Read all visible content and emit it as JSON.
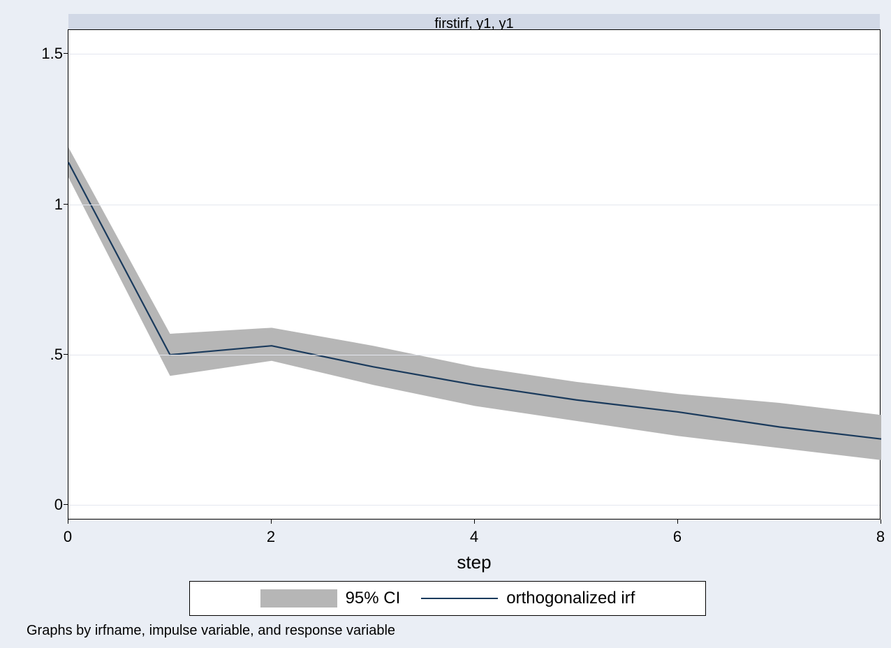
{
  "chart_data": {
    "type": "line",
    "panel_title": "firstirf, y1, y1",
    "xlabel": "step",
    "ylabel": "",
    "x_ticks": [
      0,
      2,
      4,
      6,
      8
    ],
    "y_ticks": [
      0,
      0.5,
      1,
      1.5
    ],
    "y_tick_labels": [
      "0",
      ".5",
      "1",
      "1.5"
    ],
    "xlim": [
      0,
      8
    ],
    "ylim": [
      -0.05,
      1.58
    ],
    "x": [
      0,
      1,
      2,
      3,
      4,
      5,
      6,
      7,
      8
    ],
    "series": [
      {
        "name": "orthogonalized irf",
        "values": [
          1.14,
          0.5,
          0.53,
          0.46,
          0.4,
          0.35,
          0.31,
          0.26,
          0.22
        ]
      }
    ],
    "ci_band": {
      "name": "95% CI",
      "lower": [
        1.09,
        0.43,
        0.48,
        0.4,
        0.33,
        0.28,
        0.23,
        0.19,
        0.15
      ],
      "upper": [
        1.19,
        0.57,
        0.59,
        0.53,
        0.46,
        0.41,
        0.37,
        0.34,
        0.3
      ]
    },
    "legend": [
      "95% CI",
      "orthogonalized irf"
    ],
    "footnote": "Graphs by irfname, impulse variable, and response variable",
    "colors": {
      "background": "#eaeef5",
      "plot_bg": "#ffffff",
      "band": "#b6b6b6",
      "line": "#1a3a5c",
      "grid": "#e4e7ef",
      "panel_band": "#d1d8e6"
    }
  }
}
